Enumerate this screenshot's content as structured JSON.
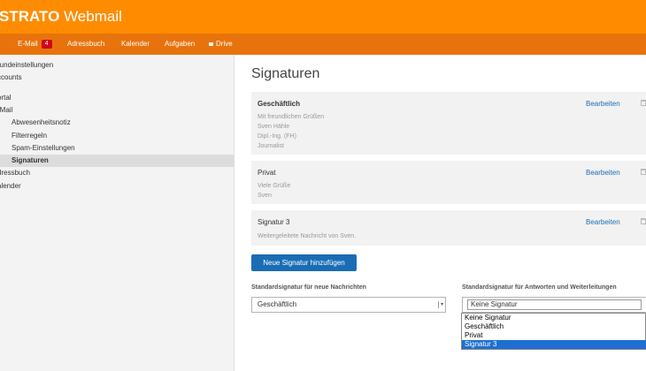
{
  "app": {
    "brand": "STRATO",
    "product": "Webmail"
  },
  "nav": {
    "items": [
      {
        "label": ""
      },
      {
        "label": "E-Mail",
        "badge": "4"
      },
      {
        "label": "Adressbuch"
      },
      {
        "label": "Kalender"
      },
      {
        "label": "Aufgaben"
      },
      {
        "label": "Drive",
        "icon": "lock-icon"
      }
    ]
  },
  "sidebar": {
    "items": [
      {
        "label": "rundeinstellungen"
      },
      {
        "label": "ccounts"
      },
      {
        "label": "ortal"
      },
      {
        "label": "-Mail"
      },
      {
        "label": "Abwesenheitsnotiz"
      },
      {
        "label": "Filterregeln"
      },
      {
        "label": "Spam-Einstellungen"
      },
      {
        "label": "Signaturen",
        "active": true
      },
      {
        "label": "dressbuch"
      },
      {
        "label": "alender"
      }
    ]
  },
  "main": {
    "title": "Signaturen",
    "edit_label": "Bearbeiten",
    "signatures": [
      {
        "name": "Geschäftlich",
        "lines": [
          "Mit freundlichen Grüßen",
          "Sven Hähle",
          "Dipl.-Ing. (FH)",
          "Journalist"
        ]
      },
      {
        "name": "Privat",
        "lines": [
          "Viele Grüße",
          "Sven"
        ]
      },
      {
        "name": "Signatur 3",
        "lines": [
          "Weitergeleitete Nachricht von Sven."
        ]
      }
    ],
    "add_button": "Neue Signatur hinzufügen",
    "default_new": {
      "label": "Standardsignatur für neue Nachrichten",
      "value": "Geschäftlich"
    },
    "default_reply": {
      "label": "Standardsignatur für Antworten und Weiterleitungen",
      "value": "Keine Signatur",
      "options": [
        "Keine Signatur",
        "Geschäftlich",
        "Privat",
        "Signatur 3"
      ],
      "highlighted": "Signatur 3"
    }
  },
  "colors": {
    "header": "#ff8c00",
    "nav": "#e8730c",
    "accent": "#1a6db5",
    "badge": "#d0021b"
  }
}
